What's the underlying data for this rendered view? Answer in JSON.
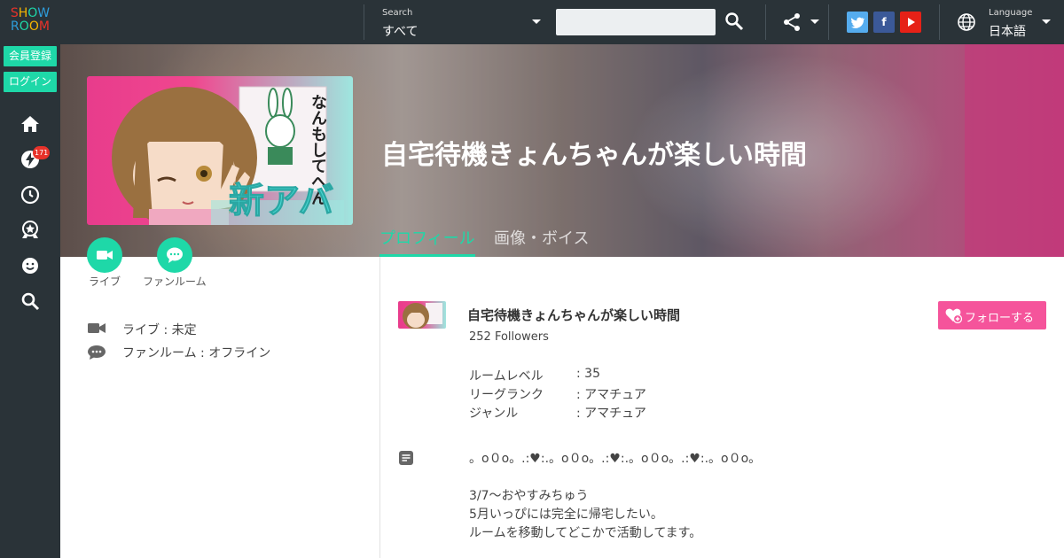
{
  "brand": {
    "logo_line1": "SHOW",
    "logo_line2": "ROOM",
    "logo_colors": [
      "#e8322a",
      "#f5b400",
      "#1ed8a8",
      "#2e9ddb"
    ]
  },
  "sidebar": {
    "signup_label": "会員登録",
    "login_label": "ログイン",
    "notification_count": "171",
    "nav_icons": [
      "home-icon",
      "lightning-icon",
      "clock-icon",
      "ranking-icon",
      "smiley-icon",
      "search-icon"
    ]
  },
  "header": {
    "search_label": "Search",
    "search_category": "すべて",
    "search_placeholder": "",
    "social_icons": [
      "twitter-icon",
      "facebook-icon",
      "youtube-icon"
    ],
    "language_label": "Language",
    "language_value": "日本語"
  },
  "colors": {
    "accent": "#1ed8a8",
    "follow": "#f5549b",
    "dark": "#2a3338",
    "twitter": "#55acee",
    "facebook": "#3b5998",
    "youtube": "#e62117"
  },
  "room": {
    "title": "自宅待機きょんちゃんが楽しい時間",
    "thumbnail_text": "なんもしてへん",
    "thumbnail_text2": "新アバ",
    "tabs": [
      "プロフィール",
      "画像・ボイス"
    ]
  },
  "actions": {
    "live_label": "ライブ",
    "fanroom_label": "ファンルーム"
  },
  "status": {
    "live": "ライブ : 未定",
    "fanroom": "ファンルーム : オフライン"
  },
  "profile": {
    "title": "自宅待機きょんちゃんが楽しい時間",
    "followers": "252 Followers",
    "follow_label": "フォローする",
    "info": [
      {
        "label": "ルームレベル",
        "value": ": 35"
      },
      {
        "label": "リーグランク",
        "value": ": アマチュア"
      },
      {
        "label": "ジャンル",
        "value": ": アマチュア"
      }
    ],
    "description": [
      "。o０o。.:♥:.。o０o。.:♥:.。o０o。.:♥:.。o０o。",
      "",
      "3/7〜おやすみちゅう",
      "5月いっぴには完全に帰宅したい。",
      "ルームを移動してどこかで活動してます。"
    ]
  }
}
